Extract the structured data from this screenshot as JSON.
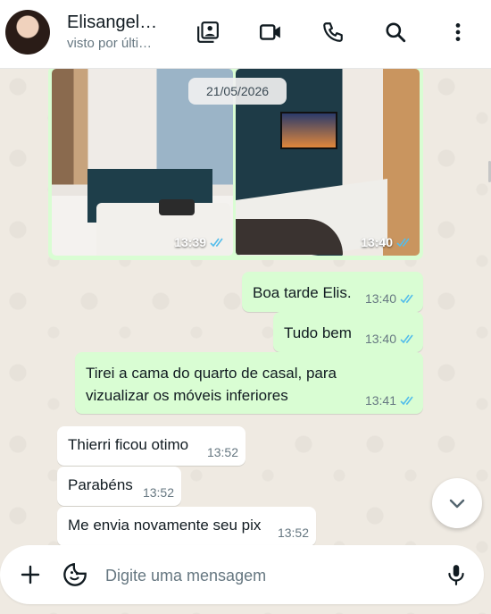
{
  "header": {
    "contact_name": "Elisangel…",
    "status": "visto por últi…",
    "icons": [
      "photo-album-icon",
      "video-call-icon",
      "phone-icon",
      "search-icon",
      "more-vert-icon"
    ]
  },
  "chat": {
    "date_chip": "21/05/2026",
    "album": {
      "photos": [
        {
          "time": "13:39"
        },
        {
          "time": "13:40"
        }
      ]
    },
    "messages": [
      {
        "text": "Boa tarde Elis.",
        "time": "13:40",
        "direction": "out"
      },
      {
        "text": "Tudo bem",
        "time": "13:40",
        "direction": "out"
      },
      {
        "text_line1": "Tirei a cama do quarto de casal, para",
        "text_line2": "vizualizar os móveis inferiores",
        "time": "13:41",
        "direction": "out"
      },
      {
        "text": "Thierri ficou otimo",
        "time": "13:52",
        "direction": "in"
      },
      {
        "text": "Parabéns",
        "time": "13:52",
        "direction": "in"
      },
      {
        "text": "Me envia novamente seu pix",
        "time": "13:52",
        "direction": "in"
      }
    ]
  },
  "composer": {
    "placeholder": "Digite uma mensagem"
  },
  "colors": {
    "outgoing_bubble": "#d9fdd3",
    "incoming_bubble": "#ffffff",
    "read_tick": "#53bdeb",
    "wallpaper": "#efeae2"
  }
}
